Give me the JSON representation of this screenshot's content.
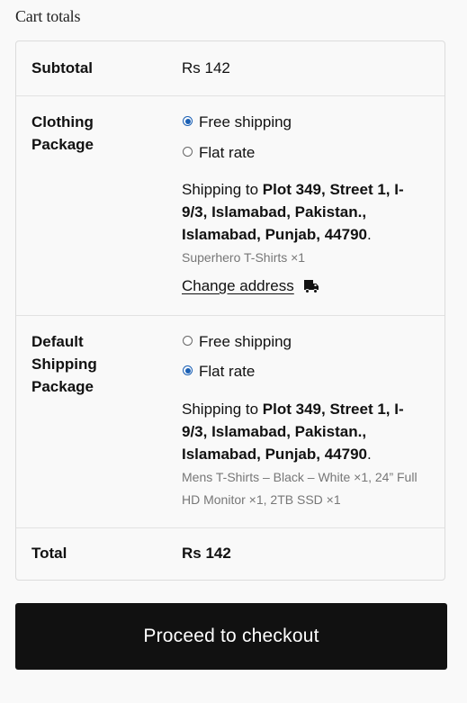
{
  "heading": "Cart totals",
  "subtotal": {
    "label": "Subtotal",
    "value": "Rs 142"
  },
  "packages": [
    {
      "label": "Clothing Package",
      "options": [
        {
          "label": "Free shipping",
          "checked": true
        },
        {
          "label": "Flat rate",
          "checked": false
        }
      ],
      "shipping_prefix": "Shipping to",
      "address": "Plot 349, Street 1, I-9/3, Islamabad, Pakistan., Islamabad, Punjab, 44790",
      "address_suffix": ".",
      "items": "Superhero T-Shirts ×1",
      "change_address": "Change address"
    },
    {
      "label": "Default Shipping Package",
      "options": [
        {
          "label": "Free shipping",
          "checked": false
        },
        {
          "label": "Flat rate",
          "checked": true
        }
      ],
      "shipping_prefix": "Shipping to",
      "address": "Plot 349, Street 1, I-9/3, Islamabad, Pakistan., Islamabad, Punjab, 44790",
      "address_suffix": ".",
      "items": "Mens T-Shirts – Black – White ×1, 24” Full HD Monitor ×1, 2TB SSD ×1"
    }
  ],
  "total": {
    "label": "Total",
    "value": "Rs 142"
  },
  "checkout_button": "Proceed to checkout",
  "icons": {
    "change_address": "truck-icon"
  },
  "colors": {
    "radio_accent": "#1a5fb4",
    "button_bg": "#111111",
    "button_text": "#ffffff"
  }
}
